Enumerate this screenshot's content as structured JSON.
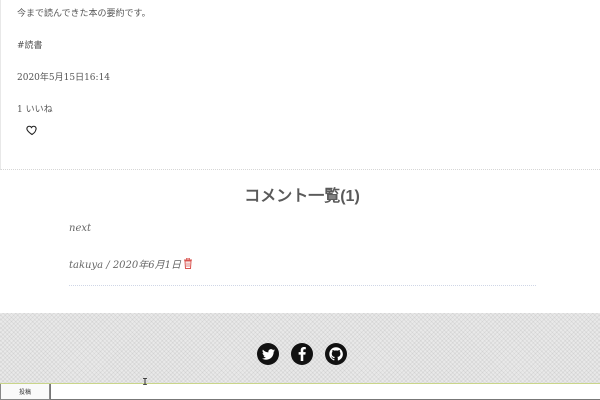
{
  "post": {
    "body": "今まで読んできた本の要約です。",
    "tag": "#読書",
    "date": "2020年5月15日16:14",
    "likes": "1 いいね"
  },
  "comments": {
    "title": "コメント一覧(1)",
    "items": [
      {
        "text": "next",
        "meta": "takuya / 2020年6月1日"
      }
    ]
  },
  "footer": {
    "social": [
      "twitter-icon",
      "facebook-icon",
      "github-icon"
    ]
  },
  "bottom_bar": {
    "post_label": "投稿",
    "input_value": ""
  },
  "colors": {
    "trash": "#d9534f",
    "social_bg": "#111111",
    "accent_line": "#c9d58a"
  }
}
